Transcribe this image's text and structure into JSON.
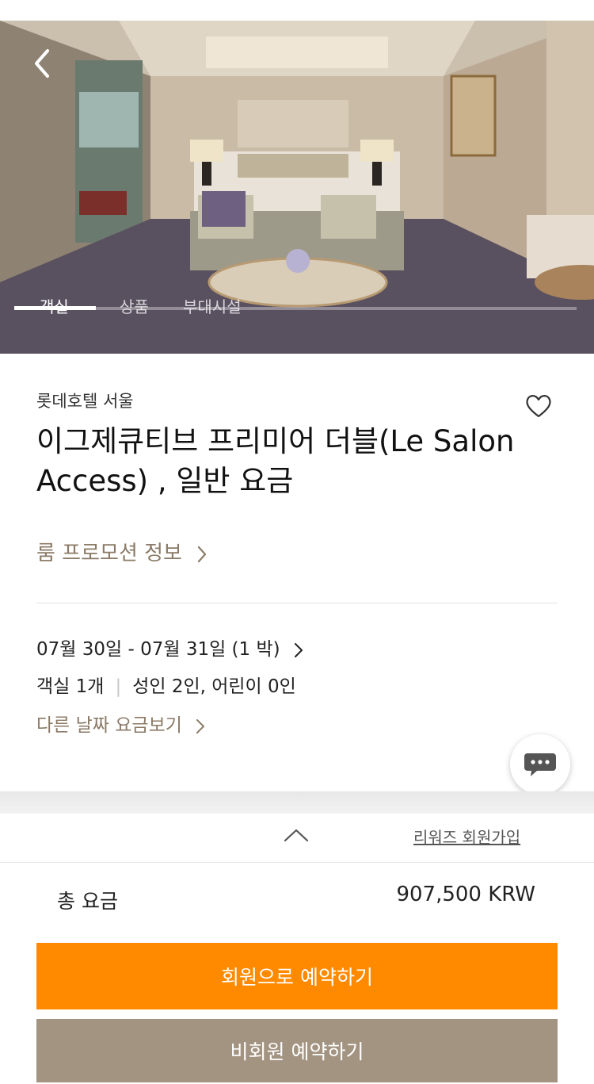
{
  "hero": {
    "tabs": [
      {
        "label": "객실",
        "active": true
      },
      {
        "label": "상품",
        "active": false
      },
      {
        "label": "부대시설",
        "active": false
      }
    ],
    "back_icon": "chevron-left-icon"
  },
  "room": {
    "hotel_name": "롯데호텔 서울",
    "title": "이그제큐티브 프리미어 더블(Le Salon Access) , 일반 요금",
    "promo_link": "룸 프로모션 정보",
    "favorite_icon": "heart-icon"
  },
  "booking": {
    "dates": "07월 30일 - 07월 31일 (1 박)",
    "rooms": "객실 1개",
    "guests": "성인 2인, 어린이 0인",
    "other_dates_link": "다른 날짜 요금보기"
  },
  "sheet": {
    "join_link": "리워즈 회원가입",
    "total_label": "총 요금",
    "total_value": "907,500 KRW",
    "member_button": "회원으로 예약하기",
    "guest_button": "비회원 예약하기"
  },
  "colors": {
    "accent_brown": "#8b7a66",
    "orange": "#ff8a00",
    "taupe": "#a39482"
  }
}
